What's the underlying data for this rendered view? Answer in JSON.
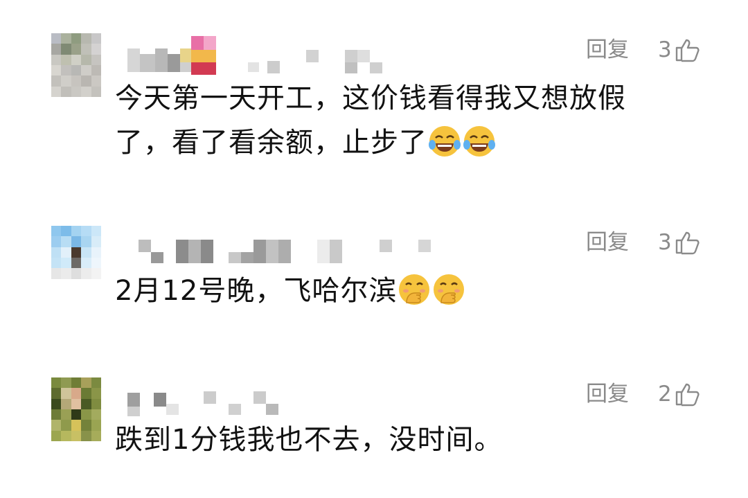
{
  "comments": [
    {
      "reply_label": "回复",
      "likes": "3",
      "text_line1": "今天第一天开工，这价钱看得我又想放假",
      "text_line2": "了，看了看余额，止步了",
      "emojis": [
        "face-with-tears-of-joy-icon",
        "face-with-tears-of-joy-icon"
      ]
    },
    {
      "reply_label": "回复",
      "likes": "3",
      "text_line1": "2月12号晚，飞哈尔滨",
      "emojis": [
        "face-with-hand-over-mouth-icon",
        "face-with-hand-over-mouth-icon"
      ]
    },
    {
      "reply_label": "回复",
      "likes": "2",
      "text_line1": "跌到1分钱我也不去，没时间。"
    }
  ],
  "colors": {
    "meta_text": "#8a8a8a",
    "body_text": "#111111",
    "emoji_yellow": "#f6c33d"
  }
}
